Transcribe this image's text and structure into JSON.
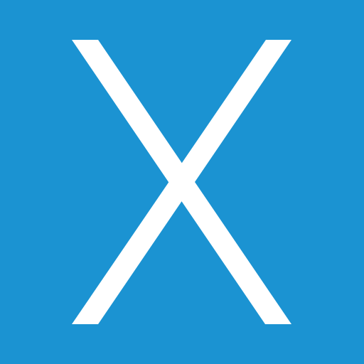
{
  "icon": {
    "name": "x-letter-icon",
    "glyph": "X",
    "background_color": "#1b93d2",
    "glyph_color": "#ffffff"
  }
}
